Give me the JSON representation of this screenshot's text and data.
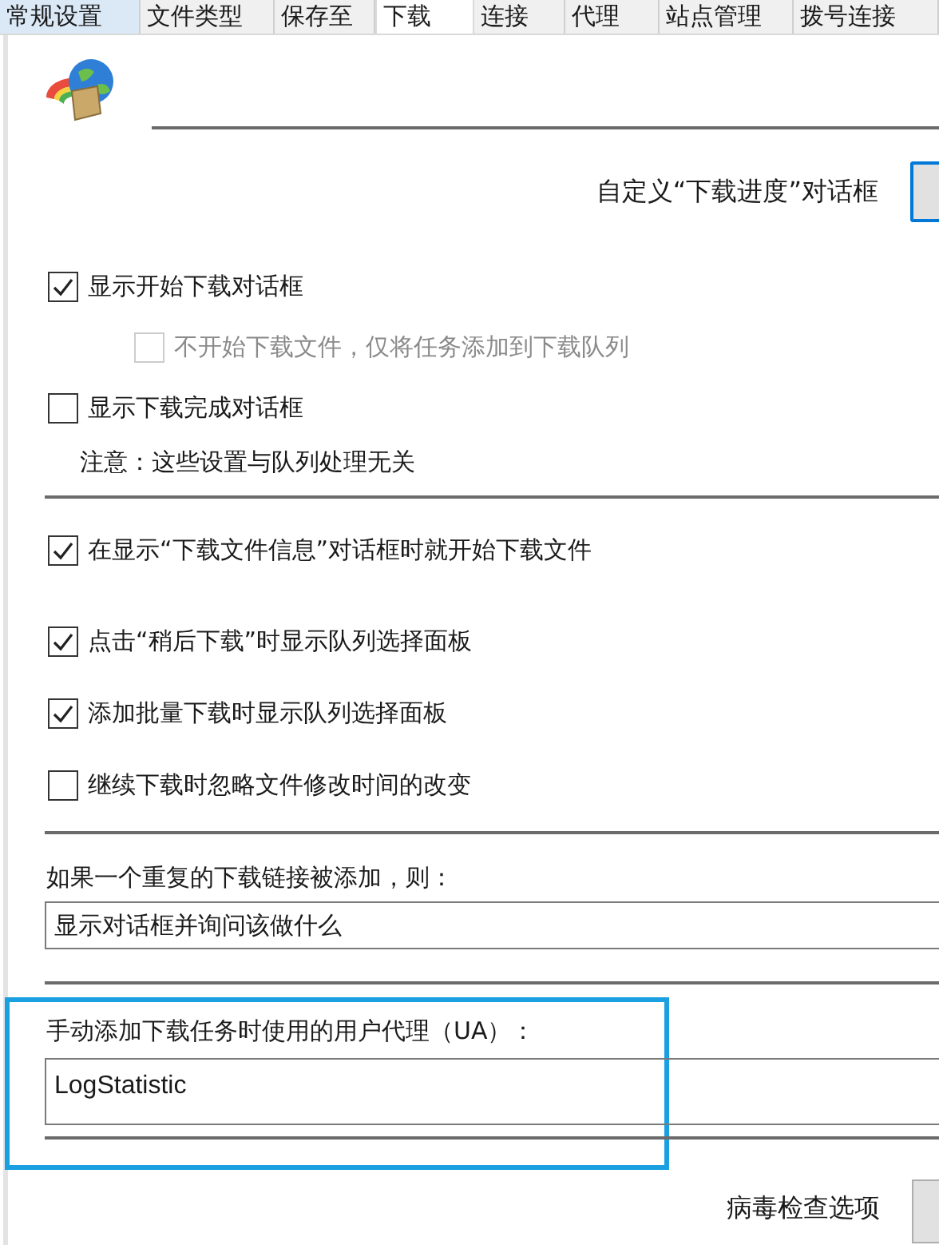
{
  "tabs": [
    {
      "label": "常规设置",
      "selected": false
    },
    {
      "label": "文件类型",
      "selected": false
    },
    {
      "label": "保存至",
      "selected": false
    },
    {
      "label": "下载",
      "selected": true
    },
    {
      "label": "连接",
      "selected": false
    },
    {
      "label": "代理",
      "selected": false
    },
    {
      "label": "站点管理",
      "selected": false
    },
    {
      "label": "拨号连接",
      "selected": false
    }
  ],
  "progress_dialog_label": "自定义“下载进度”对话框",
  "dialog_options": [
    {
      "label": "显示开始下载对话框",
      "checked": true,
      "disabled": false,
      "children": [
        {
          "label": "不开始下载文件，仅将任务添加到下载队列",
          "checked": false,
          "disabled": true
        }
      ]
    },
    {
      "label": "显示下载完成对话框",
      "checked": false,
      "disabled": false
    }
  ],
  "note": "注意：这些设置与队列处理无关",
  "other_options": [
    {
      "label": "在显示“下载文件信息”对话框时就开始下载文件",
      "checked": true,
      "disabled": false
    },
    {
      "label": "点击“稍后下载”时显示队列选择面板",
      "checked": true,
      "disabled": false
    },
    {
      "label": "添加批量下载时显示队列选择面板",
      "checked": true,
      "disabled": false
    },
    {
      "label": "继续下载时忽略文件修改时间的改变",
      "checked": false,
      "disabled": false
    }
  ],
  "duplicate": {
    "label": "如果一个重复的下载链接被添加，则：",
    "value": "显示对话框并询问该做什么"
  },
  "user_agent": {
    "label": "手动添加下载任务时使用的用户代理（UA）：",
    "value": "LogStatistic"
  },
  "virus_label": "病毒检查选项"
}
